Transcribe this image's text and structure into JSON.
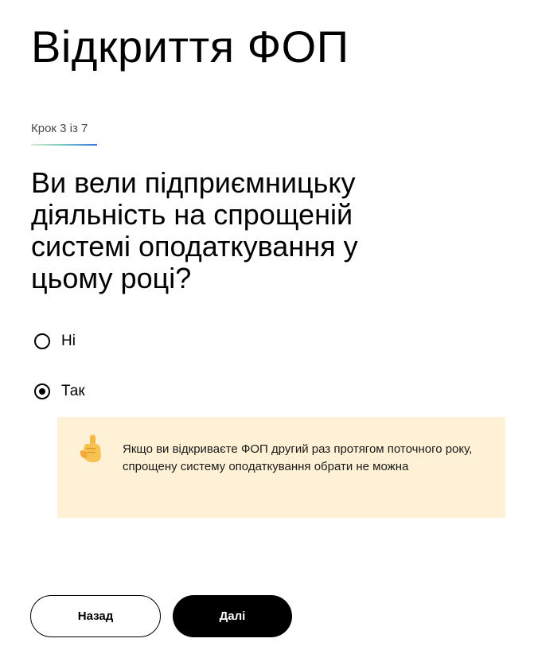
{
  "header": {
    "title": "Відкриття ФОП"
  },
  "progress": {
    "label": "Крок 3 із 7",
    "current": 3,
    "total": 7
  },
  "question": {
    "text": "Ви вели підприємницьку діяльність на спрощеній системі оподаткування у цьому році?"
  },
  "options": [
    {
      "label": "Ні",
      "selected": false
    },
    {
      "label": "Так",
      "selected": true
    }
  ],
  "notice": {
    "icon": "pointing-up-hand-icon",
    "text": "Якщо ви відкриваєте ФОП другий раз протягом поточного року, спрощену систему оподаткування обрати не можна",
    "background": "#fff1d6"
  },
  "buttons": {
    "back_label": "Назад",
    "next_label": "Далі"
  }
}
